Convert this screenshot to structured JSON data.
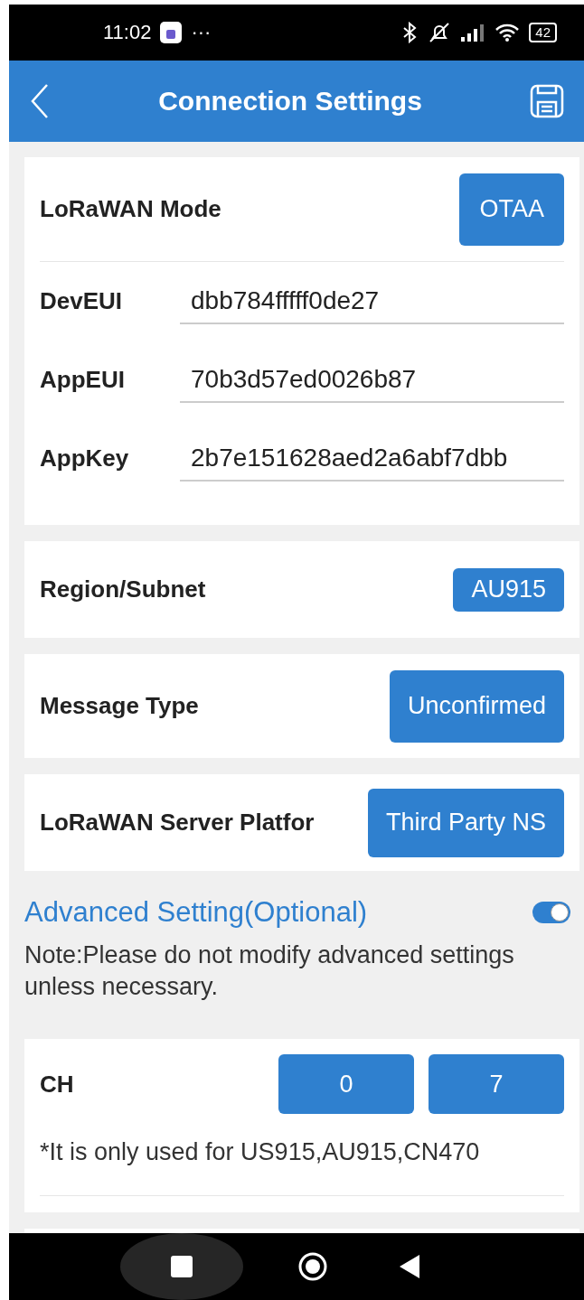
{
  "status_bar": {
    "time": "11:02",
    "more": "···",
    "battery": "42"
  },
  "header": {
    "title": "Connection Settings"
  },
  "mode_card": {
    "label": "LoRaWAN Mode",
    "button": "OTAA",
    "fields": [
      {
        "label": "DevEUI",
        "value": "dbb784fffff0de27"
      },
      {
        "label": "AppEUI",
        "value": "70b3d57ed0026b87"
      },
      {
        "label": "AppKey",
        "value": "2b7e151628aed2a6abf7dbb"
      }
    ]
  },
  "option_cards": [
    {
      "label": "Region/Subnet",
      "button": "AU915"
    },
    {
      "label": "Message Type",
      "button": "Unconfirmed"
    },
    {
      "label": "LoRaWAN Server Platfor",
      "button": "Third Party NS"
    }
  ],
  "advanced": {
    "title": "Advanced Setting(Optional)",
    "on": true,
    "note": "Note:Please do not modify advanced settings unless necessary."
  },
  "ch_card": {
    "label": "CH",
    "buttons": [
      "0",
      "7"
    ],
    "hint": "*It is only used for US915,AU915,CN470"
  }
}
